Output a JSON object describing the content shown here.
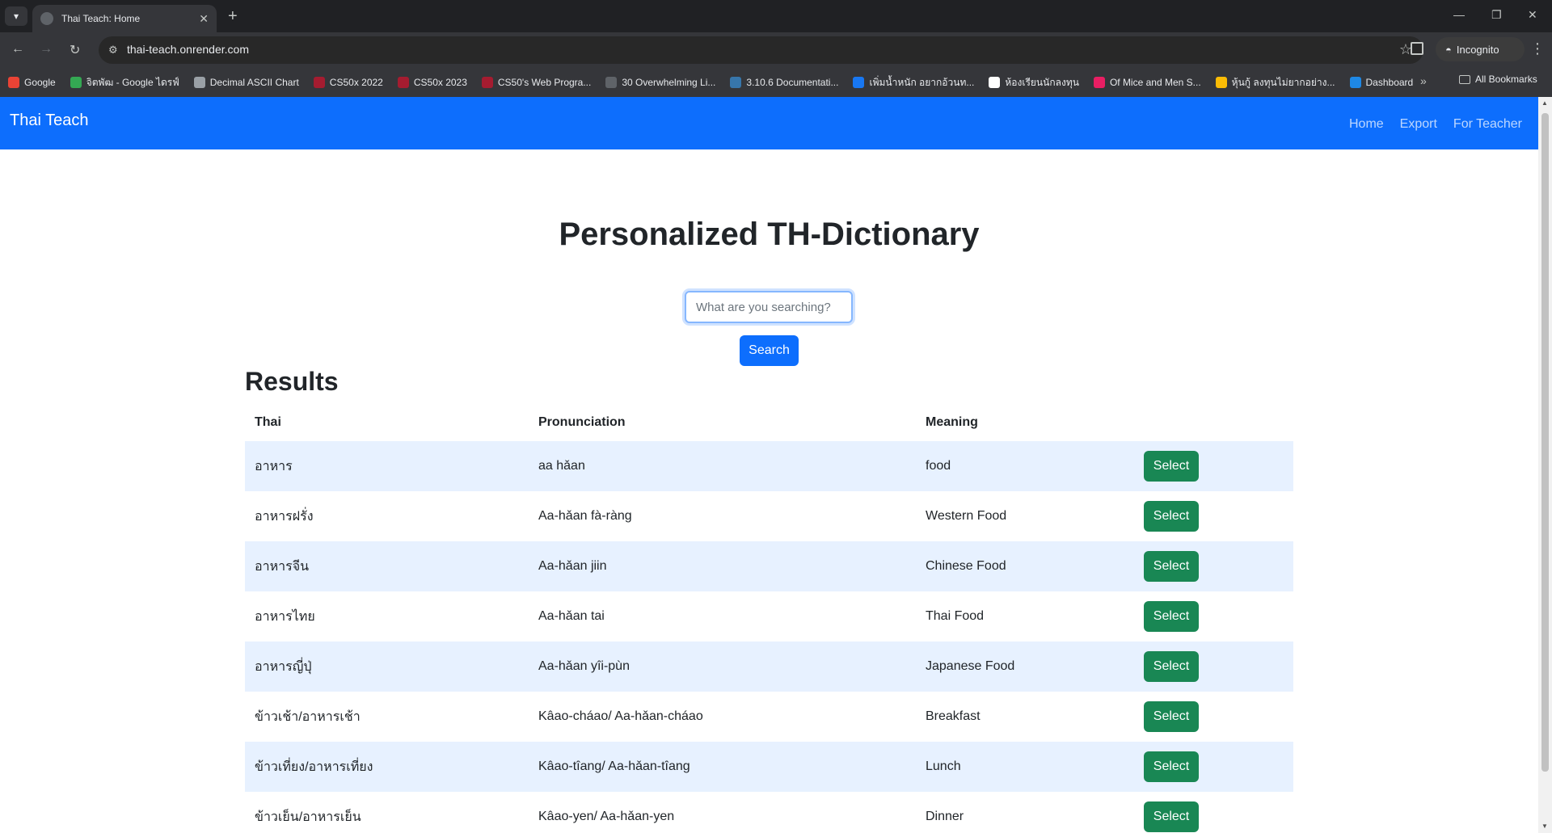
{
  "browser": {
    "tab_title": "Thai Teach: Home",
    "url": "thai-teach.onrender.com",
    "incognito_label": "Incognito",
    "bookmarks": [
      {
        "label": "Google",
        "color": "#ea4335"
      },
      {
        "label": "จิตพัฒ - Google ไดรฟ์",
        "color": "#34a853"
      },
      {
        "label": "Decimal ASCII Chart",
        "color": "#9aa0a6"
      },
      {
        "label": "CS50x 2022",
        "color": "#a51c30"
      },
      {
        "label": "CS50x 2023",
        "color": "#a51c30"
      },
      {
        "label": "CS50's Web Progra...",
        "color": "#a51c30"
      },
      {
        "label": "30 Overwhelming Li...",
        "color": "#5f6368"
      },
      {
        "label": "3.10.6 Documentati...",
        "color": "#3776ab"
      },
      {
        "label": "เพิ่มน้ำหนัก อยากอ้วนท...",
        "color": "#1877f2"
      },
      {
        "label": "ห้องเรียนนักลงทุน",
        "color": "#ffffff"
      },
      {
        "label": "Of Mice and Men S...",
        "color": "#e91e63"
      },
      {
        "label": "หุ้นกู้ ลงทุนไม่ยากอย่าง...",
        "color": "#fbbc05"
      },
      {
        "label": "Dashboard",
        "color": "#1e88e5"
      }
    ],
    "all_bookmarks_label": "All Bookmarks"
  },
  "navbar": {
    "brand": "Thai Teach",
    "links": [
      "Home",
      "Export",
      "For Teacher"
    ]
  },
  "main": {
    "heading": "Personalized TH-Dictionary",
    "search_placeholder": "What are you searching?",
    "search_button": "Search",
    "results_title": "Results",
    "columns": [
      "Thai",
      "Pronunciation",
      "Meaning"
    ],
    "select_label": "Select",
    "rows": [
      {
        "thai": "อาหาร",
        "pronunciation": "aa hǎan",
        "meaning": "food"
      },
      {
        "thai": "อาหารฝรั่ง",
        "pronunciation": "Aa-hǎan fà-ràng",
        "meaning": "Western Food"
      },
      {
        "thai": "อาหารจีน",
        "pronunciation": "Aa-hǎan jiin",
        "meaning": "Chinese Food"
      },
      {
        "thai": "อาหารไทย",
        "pronunciation": "Aa-hǎan tai",
        "meaning": "Thai Food"
      },
      {
        "thai": "อาหารญี่ปุ่",
        "pronunciation": "Aa-hǎan yîi-pùn",
        "meaning": "Japanese Food"
      },
      {
        "thai": "ข้าวเช้า/อาหารเช้า",
        "pronunciation": "Kâao-cháao/ Aa-hǎan-cháao",
        "meaning": "Breakfast"
      },
      {
        "thai": "ข้าวเที่ยง/อาหารเที่ยง",
        "pronunciation": "Kâao-tîang/ Aa-hǎan-tîang",
        "meaning": "Lunch"
      },
      {
        "thai": "ข้าวเย็น/อาหารเย็น",
        "pronunciation": "Kâao-yen/ Aa-hǎan-yen",
        "meaning": "Dinner"
      }
    ]
  }
}
